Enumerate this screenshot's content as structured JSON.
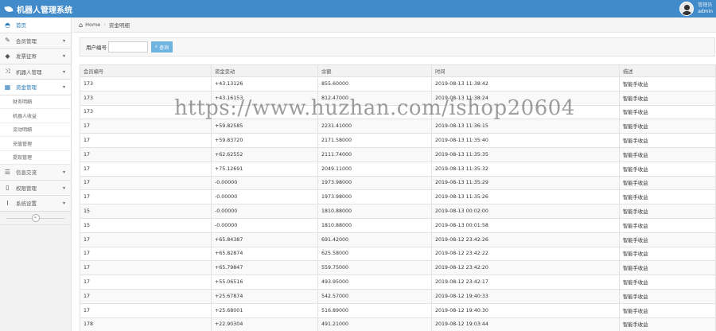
{
  "header": {
    "app_title": "机器人管理系统",
    "user_role": "管理员",
    "user_name": "admin"
  },
  "sidebar": {
    "items": [
      {
        "label": "首页",
        "icon": "dashboard-icon"
      },
      {
        "label": "会员管理",
        "icon": "edit-icon"
      },
      {
        "label": "发票征寄",
        "icon": "tag-icon"
      },
      {
        "label": "机器人管理",
        "icon": "shuffle-icon"
      },
      {
        "label": "资金管理",
        "icon": "calendar-icon"
      },
      {
        "label": "信息交流",
        "icon": "list-icon"
      },
      {
        "label": "权限管理",
        "icon": "file-icon"
      },
      {
        "label": "系统设置",
        "icon": "text-height-icon"
      }
    ],
    "subitems": [
      "财务明细",
      "机器人收益",
      "流动明细",
      "充值管理",
      "提现管理"
    ]
  },
  "breadcrumb": {
    "home": "Home",
    "current": "资金明细"
  },
  "search": {
    "label": "用户编号",
    "value": "",
    "button": "查询"
  },
  "table": {
    "columns": [
      "会员编号",
      "资金变动",
      "余额",
      "时间",
      "描述"
    ],
    "rows": [
      [
        "173",
        "+43.13126",
        "855.60000",
        "2019-08-13 11:38:42",
        "智能手收益"
      ],
      [
        "173",
        "+43.16153",
        "812.47000",
        "2019-08-13 11:38:24",
        "智能手收益"
      ],
      [
        "173",
        "",
        "",
        "",
        "智能手收益"
      ],
      [
        "17",
        "+59.82585",
        "2231.41000",
        "2019-08-13 11:36:15",
        "智能手收益"
      ],
      [
        "17",
        "+59.83720",
        "2171.58000",
        "2019-08-13 11:35:40",
        "智能手收益"
      ],
      [
        "17",
        "+62.62552",
        "2111.74000",
        "2019-08-13 11:35:35",
        "智能手收益"
      ],
      [
        "17",
        "+75.12691",
        "2049.11000",
        "2019-08-13 11:35:32",
        "智能手收益"
      ],
      [
        "17",
        "-0.00000",
        "1973.98000",
        "2019-08-13 11:35:29",
        "智能手收益"
      ],
      [
        "17",
        "-0.00000",
        "1973.98000",
        "2019-08-13 11:35:26",
        "智能手收益"
      ],
      [
        "15",
        "-0.00000",
        "1810.88000",
        "2019-08-13 00:02:00",
        "智能手收益"
      ],
      [
        "15",
        "-0.00000",
        "1810.88000",
        "2019-08-13 00:01:58",
        "智能手收益"
      ],
      [
        "17",
        "+65.84387",
        "691.42000",
        "2019-08-12 23:42:26",
        "智能手收益"
      ],
      [
        "17",
        "+65.82874",
        "625.58000",
        "2019-08-12 23:42:22",
        "智能手收益"
      ],
      [
        "17",
        "+65.79847",
        "559.75000",
        "2019-08-12 23:42:20",
        "智能手收益"
      ],
      [
        "17",
        "+55.06516",
        "493.95000",
        "2019-08-12 23:42:17",
        "智能手收益"
      ],
      [
        "17",
        "+25.67874",
        "542.57000",
        "2019-08-12 19:40:33",
        "智能手收益"
      ],
      [
        "17",
        "+25.68001",
        "516.89000",
        "2019-08-12 19:40:30",
        "智能手收益"
      ],
      [
        "178",
        "+22.90304",
        "491.21000",
        "2019-08-12 19:03:44",
        "智能手收益"
      ]
    ]
  },
  "watermark": "https://www.huzhan.com/ishop20604",
  "colors": {
    "topbar": "#428bca",
    "active": "#2b7dbc",
    "search_button": "#6fb3e0"
  }
}
